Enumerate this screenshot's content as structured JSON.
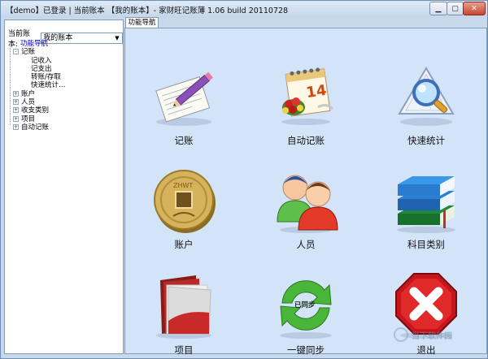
{
  "window": {
    "title": "【demo】已登录 | 当前账本 【我的账本】- 家财旺记账薄 1.06 build 20110728"
  },
  "sidebar": {
    "account_label": "当前账本:",
    "account_value": "我的账本",
    "tree": [
      {
        "label": "功能导航",
        "level": "root"
      },
      {
        "label": "记账",
        "level": "l0",
        "expander": "-"
      },
      {
        "label": "记收入",
        "level": "child"
      },
      {
        "label": "记支出",
        "level": "child"
      },
      {
        "label": "转账/存取",
        "level": "child"
      },
      {
        "label": "快速统计…",
        "level": "child"
      },
      {
        "label": "账户",
        "level": "l0",
        "expander": "+"
      },
      {
        "label": "人员",
        "level": "l0",
        "expander": "+"
      },
      {
        "label": "收支类别",
        "level": "l0",
        "expander": "+"
      },
      {
        "label": "项目",
        "level": "l0",
        "expander": "+"
      },
      {
        "label": "自动记账",
        "level": "l0",
        "expander": "+"
      }
    ]
  },
  "tabs": [
    {
      "label": "功能导航"
    }
  ],
  "nav": {
    "items": [
      {
        "label": "记账",
        "icon": "notepad-pencil-icon"
      },
      {
        "label": "自动记账",
        "icon": "calendar-flowers-icon"
      },
      {
        "label": "快速统计",
        "icon": "magnifier-icon"
      },
      {
        "label": "账户",
        "icon": "coin-icon"
      },
      {
        "label": "人员",
        "icon": "people-icon"
      },
      {
        "label": "科目类别",
        "icon": "books-icon"
      },
      {
        "label": "项目",
        "icon": "folder-icon"
      },
      {
        "label": "一键同步",
        "icon": "sync-arrows-icon",
        "badge": "已同步"
      },
      {
        "label": "退出",
        "icon": "exit-stop-icon"
      }
    ]
  },
  "watermark": {
    "text": "当下软件园"
  },
  "colors": {
    "main_bg": "#d3e3f8",
    "window_border": "#6d8fb8",
    "tree_root": "#0000cc"
  }
}
